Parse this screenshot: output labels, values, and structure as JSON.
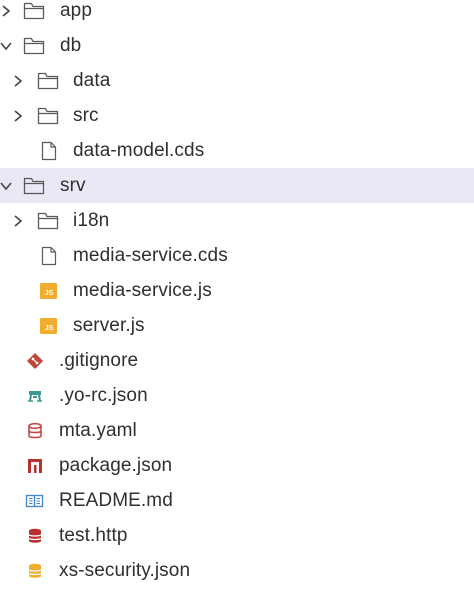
{
  "explorer": {
    "colors": {
      "selected_row": "#e9e9f6",
      "folder_stroke": "#5a5a5a",
      "js_badge": "#f0ad2e",
      "git": "#c2453a",
      "yeoman": "#3a9a92",
      "db_red": "#c24a4a",
      "npm_red": "#b83232",
      "readme_blue": "#4a88c8",
      "security_orange": "#f0ad2e"
    },
    "items": [
      {
        "label": "app",
        "type": "folder",
        "expanded": false,
        "icon": "folder-icon"
      },
      {
        "label": "db",
        "type": "folder",
        "expanded": true,
        "icon": "folder-icon"
      },
      {
        "label": "data",
        "type": "folder",
        "expanded": false,
        "icon": "folder-icon"
      },
      {
        "label": "src",
        "type": "folder",
        "expanded": false,
        "icon": "folder-icon"
      },
      {
        "label": "data-model.cds",
        "type": "file",
        "icon": "file-icon"
      },
      {
        "label": "srv",
        "type": "folder",
        "expanded": true,
        "selected": true,
        "icon": "folder-icon"
      },
      {
        "label": "i18n",
        "type": "folder",
        "expanded": false,
        "icon": "folder-icon"
      },
      {
        "label": "media-service.cds",
        "type": "file",
        "icon": "file-icon"
      },
      {
        "label": "media-service.js",
        "type": "file",
        "icon": "js-icon"
      },
      {
        "label": "server.js",
        "type": "file",
        "icon": "js-icon"
      },
      {
        "label": ".gitignore",
        "type": "file",
        "icon": "git-icon"
      },
      {
        "label": ".yo-rc.json",
        "type": "file",
        "icon": "yeoman-icon"
      },
      {
        "label": "mta.yaml",
        "type": "file",
        "icon": "database-icon"
      },
      {
        "label": "package.json",
        "type": "file",
        "icon": "npm-icon"
      },
      {
        "label": "README.md",
        "type": "file",
        "icon": "readme-icon"
      },
      {
        "label": "test.http",
        "type": "file",
        "icon": "http-icon"
      },
      {
        "label": "xs-security.json",
        "type": "file",
        "icon": "security-icon"
      }
    ]
  }
}
